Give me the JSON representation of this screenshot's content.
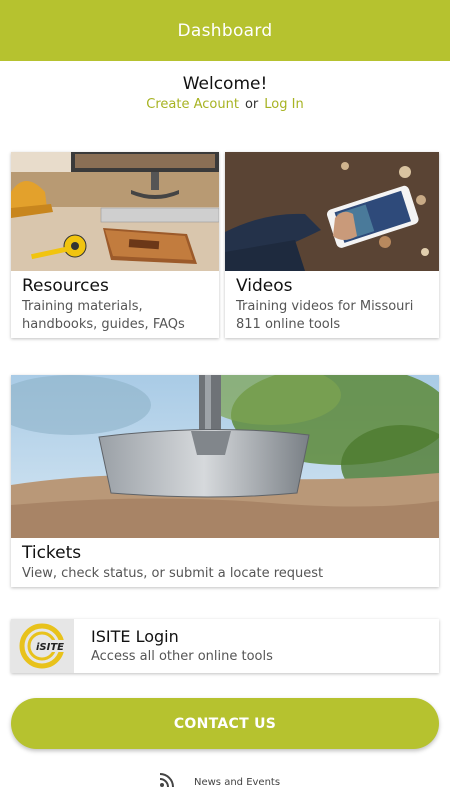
{
  "header": {
    "title": "Dashboard"
  },
  "welcome": {
    "title": "Welcome!",
    "create_account": "Create Acount",
    "or": "or",
    "login": "Log In"
  },
  "cards": {
    "resources": {
      "title": "Resources",
      "subtitle": "Training materials, handbooks, guides, FAQs"
    },
    "videos": {
      "title": "Videos",
      "subtitle": "Training videos for Missouri 811 online tools"
    },
    "tickets": {
      "title": "Tickets",
      "subtitle": "View, check status, or submit a locate request"
    },
    "isite": {
      "title": "ISITE Login",
      "subtitle": "Access all other online tools",
      "logo_text": "iSITE"
    }
  },
  "contact": {
    "label": "CONTACT US"
  },
  "news": {
    "label": "News and Events",
    "icon": "rss-icon"
  },
  "colors": {
    "accent": "#b6c22f",
    "link": "#a7b322"
  }
}
